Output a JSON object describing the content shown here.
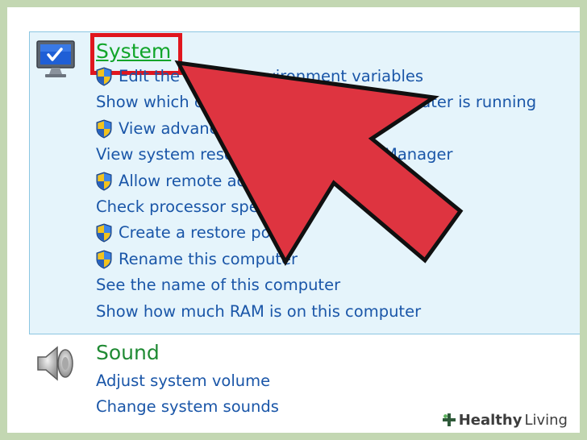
{
  "system": {
    "title": "System",
    "links": [
      {
        "label": "Edit the system environment variables",
        "shield": true
      },
      {
        "label": "Show which operating system your computer is running",
        "shield": false
      },
      {
        "label": "View advanced system settings",
        "shield": true
      },
      {
        "label": "View system resource usage in Task Manager",
        "shield": false
      },
      {
        "label": "Allow remote access to your computer",
        "shield": true
      },
      {
        "label": "Check processor speed",
        "shield": false
      },
      {
        "label": "Create a restore point",
        "shield": true
      },
      {
        "label": "Rename this computer",
        "shield": true
      },
      {
        "label": "See the name of this computer",
        "shield": false
      },
      {
        "label": "Show how much RAM is on this computer",
        "shield": false
      }
    ]
  },
  "sound": {
    "title": "Sound",
    "links": [
      {
        "label": "Adjust system volume"
      },
      {
        "label": "Change system sounds"
      }
    ]
  },
  "watermark": {
    "brand": "Healthy",
    "brand2": "Living"
  },
  "colors": {
    "panel_bg": "#e5f4fb",
    "link": "#1a56a8",
    "title_green": "#11a52a",
    "highlight_red": "#e0161e",
    "arrow_red": "#de3440"
  },
  "icons": {
    "system": "monitor-icon",
    "sound": "speaker-icon",
    "shield": "uac-shield-icon"
  }
}
